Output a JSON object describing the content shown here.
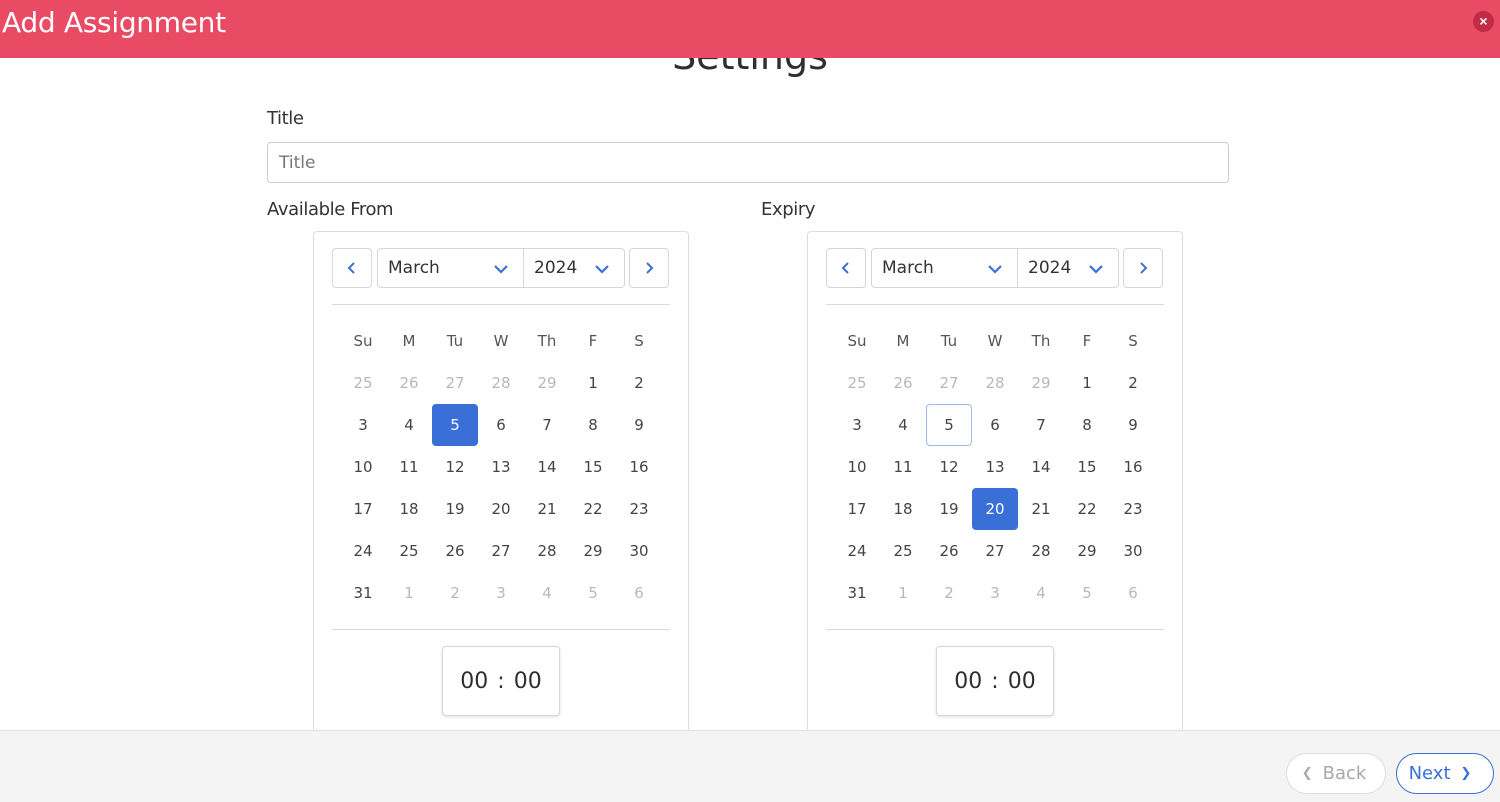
{
  "header": {
    "title": "Add Assignment",
    "close_icon": "×"
  },
  "page": {
    "section_title": "Settings"
  },
  "title_field": {
    "label": "Title",
    "placeholder": "Title"
  },
  "available_from": {
    "label": "Available From",
    "month": "March",
    "year": "2024",
    "weekdays": [
      "Su",
      "M",
      "Tu",
      "W",
      "Th",
      "F",
      "S"
    ],
    "weeks": [
      [
        {
          "d": "25",
          "m": true
        },
        {
          "d": "26",
          "m": true
        },
        {
          "d": "27",
          "m": true
        },
        {
          "d": "28",
          "m": true
        },
        {
          "d": "29",
          "m": true
        },
        {
          "d": "1"
        },
        {
          "d": "2"
        }
      ],
      [
        {
          "d": "3"
        },
        {
          "d": "4"
        },
        {
          "d": "5",
          "selected": true
        },
        {
          "d": "6"
        },
        {
          "d": "7"
        },
        {
          "d": "8"
        },
        {
          "d": "9"
        }
      ],
      [
        {
          "d": "10"
        },
        {
          "d": "11"
        },
        {
          "d": "12"
        },
        {
          "d": "13"
        },
        {
          "d": "14"
        },
        {
          "d": "15"
        },
        {
          "d": "16"
        }
      ],
      [
        {
          "d": "17"
        },
        {
          "d": "18"
        },
        {
          "d": "19"
        },
        {
          "d": "20"
        },
        {
          "d": "21"
        },
        {
          "d": "22"
        },
        {
          "d": "23"
        }
      ],
      [
        {
          "d": "24"
        },
        {
          "d": "25"
        },
        {
          "d": "26"
        },
        {
          "d": "27"
        },
        {
          "d": "28"
        },
        {
          "d": "29"
        },
        {
          "d": "30"
        }
      ],
      [
        {
          "d": "31"
        },
        {
          "d": "1",
          "m": true
        },
        {
          "d": "2",
          "m": true
        },
        {
          "d": "3",
          "m": true
        },
        {
          "d": "4",
          "m": true
        },
        {
          "d": "5",
          "m": true
        },
        {
          "d": "6",
          "m": true
        }
      ]
    ],
    "hours": "00",
    "minutes": "00"
  },
  "expiry": {
    "label": "Expiry",
    "month": "March",
    "year": "2024",
    "weekdays": [
      "Su",
      "M",
      "Tu",
      "W",
      "Th",
      "F",
      "S"
    ],
    "weeks": [
      [
        {
          "d": "25",
          "m": true
        },
        {
          "d": "26",
          "m": true
        },
        {
          "d": "27",
          "m": true
        },
        {
          "d": "28",
          "m": true
        },
        {
          "d": "29",
          "m": true
        },
        {
          "d": "1"
        },
        {
          "d": "2"
        }
      ],
      [
        {
          "d": "3"
        },
        {
          "d": "4"
        },
        {
          "d": "5",
          "today": true
        },
        {
          "d": "6"
        },
        {
          "d": "7"
        },
        {
          "d": "8"
        },
        {
          "d": "9"
        }
      ],
      [
        {
          "d": "10"
        },
        {
          "d": "11"
        },
        {
          "d": "12"
        },
        {
          "d": "13"
        },
        {
          "d": "14"
        },
        {
          "d": "15"
        },
        {
          "d": "16"
        }
      ],
      [
        {
          "d": "17"
        },
        {
          "d": "18"
        },
        {
          "d": "19"
        },
        {
          "d": "20",
          "selected": true
        },
        {
          "d": "21"
        },
        {
          "d": "22"
        },
        {
          "d": "23"
        }
      ],
      [
        {
          "d": "24"
        },
        {
          "d": "25"
        },
        {
          "d": "26"
        },
        {
          "d": "27"
        },
        {
          "d": "28"
        },
        {
          "d": "29"
        },
        {
          "d": "30"
        }
      ],
      [
        {
          "d": "31"
        },
        {
          "d": "1",
          "m": true
        },
        {
          "d": "2",
          "m": true
        },
        {
          "d": "3",
          "m": true
        },
        {
          "d": "4",
          "m": true
        },
        {
          "d": "5",
          "m": true
        },
        {
          "d": "6",
          "m": true
        }
      ]
    ],
    "hours": "00",
    "minutes": "00"
  },
  "footer": {
    "back_label": "Back",
    "next_label": "Next"
  },
  "colors": {
    "header": "#ea4b64",
    "accent": "#3a6fd8"
  },
  "icons": {
    "prev": "chevron-left-icon",
    "next": "chevron-right-icon",
    "dropdown": "chevron-down-icon",
    "close": "close-icon"
  }
}
